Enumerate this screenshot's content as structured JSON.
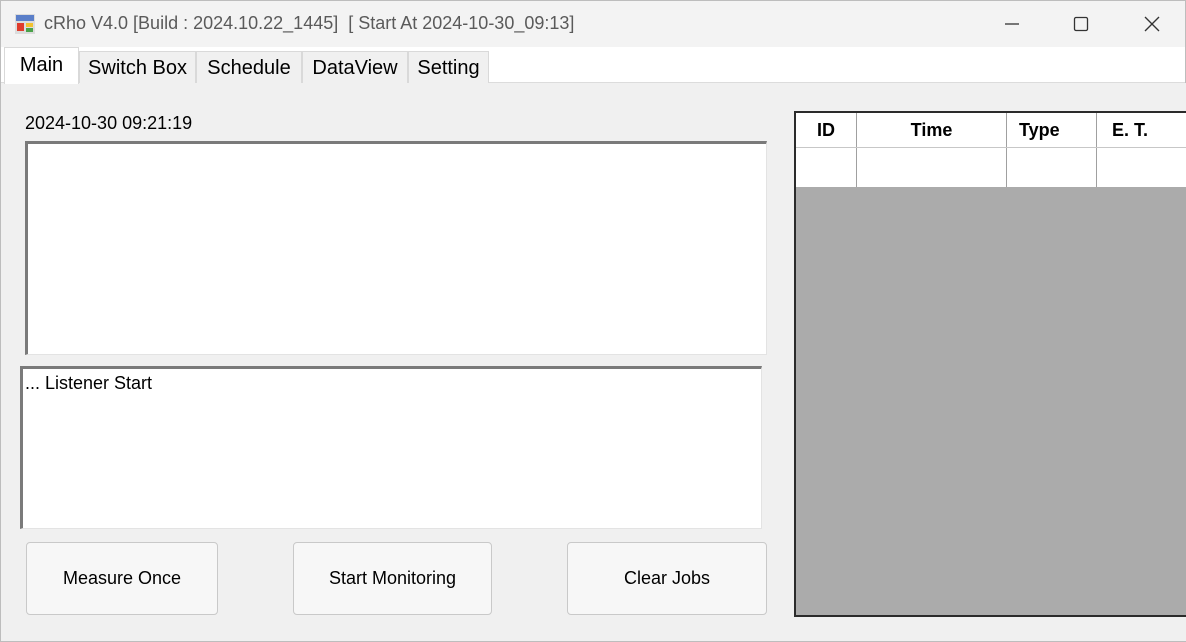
{
  "window": {
    "title": "cRho V4.0 [Build : 2024.10.22_1445]  [ Start At 2024-10-30_09:13]",
    "icon": "app-icon",
    "controls": [
      "minimize-icon",
      "maximize-icon",
      "close-icon"
    ]
  },
  "tabs": [
    {
      "label": "Main",
      "active": true
    },
    {
      "label": "Switch Box",
      "active": false
    },
    {
      "label": "Schedule",
      "active": false
    },
    {
      "label": "DataView",
      "active": false
    },
    {
      "label": "Setting",
      "active": false
    }
  ],
  "main": {
    "datetime": "2024-10-30 09:21:19",
    "log_text": "... Listener Start"
  },
  "buttons": {
    "measure_once": "Measure Once",
    "start_monitoring": "Start Monitoring",
    "clear_jobs": "Clear Jobs"
  },
  "jobs_grid": {
    "columns": [
      "ID",
      "Time",
      "Type",
      "E. T."
    ],
    "rows": [
      [
        "",
        "",
        "",
        ""
      ]
    ]
  },
  "colors": {
    "grid_background": "#ababab",
    "window_background": "#f0f0f0"
  }
}
